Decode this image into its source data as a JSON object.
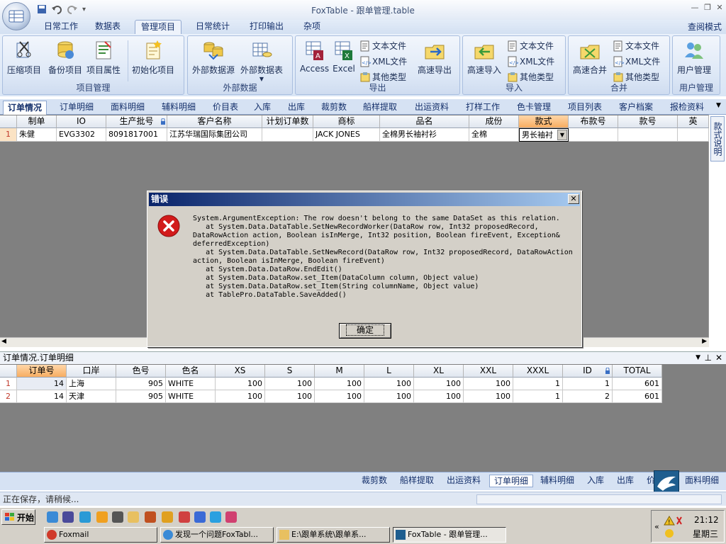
{
  "window": {
    "title": "FoxTable - 跟单管理.table"
  },
  "ribbon_tabs": [
    "日常工作",
    "数据表",
    "管理项目",
    "日常统计",
    "打印输出",
    "杂项"
  ],
  "read_mode": "查阅模式",
  "groups": {
    "project": {
      "label": "项目管理",
      "buttons": [
        "压缩项目",
        "备份项目",
        "项目属性",
        "初始化项目"
      ]
    },
    "external": {
      "label": "外部数据",
      "buttons": [
        "外部数据源",
        "外部数据表"
      ]
    },
    "export": {
      "label": "导出",
      "big": [
        "Access",
        "Excel"
      ],
      "small": [
        "文本文件",
        "XML文件",
        "其他类型"
      ],
      "fast": "高速导出"
    },
    "import": {
      "label": "导入",
      "fast": "高速导入",
      "small": [
        "文本文件",
        "XML文件",
        "其他类型"
      ]
    },
    "merge": {
      "label": "合并",
      "fast": "高速合并",
      "small": [
        "文本文件",
        "XML文件",
        "其他类型"
      ]
    },
    "users": {
      "label": "用户管理",
      "button": "用户管理"
    }
  },
  "doc_tabs": [
    "订单情况",
    "订单明细",
    "面料明细",
    "辅料明细",
    "价目表",
    "入库",
    "出库",
    "裁剪数",
    "船样提取",
    "出运资料",
    "打样工作",
    "色卡管理",
    "项目列表",
    "客户档案",
    "报检资料"
  ],
  "side_tab": "款式说明",
  "top_grid": {
    "headers": [
      "制单",
      "IO",
      "生产批号",
      "客户名称",
      "计划订单数",
      "商标",
      "品名",
      "成份",
      "款式",
      "布款号",
      "款号",
      "英"
    ],
    "row": {
      "num": "1",
      "cells": [
        "朱健",
        "EVG3302",
        "8091817001",
        "江苏华瑞国际集团公司",
        "",
        "JACK JONES",
        "全棉男长袖衬衫",
        "全棉",
        "男长袖衬",
        "",
        "",
        ""
      ]
    }
  },
  "dialog": {
    "title": "错误",
    "message": "System.ArgumentException: The row doesn't belong to the same DataSet as this relation.\n   at System.Data.DataTable.SetNewRecordWorker(DataRow row, Int32 proposedRecord, DataRowAction action, Boolean isInMerge, Int32 position, Boolean fireEvent, Exception& deferredException)\n   at System.Data.DataTable.SetNewRecord(DataRow row, Int32 proposedRecord, DataRowAction action, Boolean isInMerge, Boolean fireEvent)\n   at System.Data.DataRow.EndEdit()\n   at System.Data.DataRow.set_Item(DataColumn column, Object value)\n   at System.Data.DataRow.set_Item(String columnName, Object value)\n   at TablePro.DataTable.SaveAdded()",
    "ok": "确定"
  },
  "lower_panel": {
    "title": "订单情况.订单明细",
    "headers": [
      "订单号",
      "口岸",
      "色号",
      "色名",
      "XS",
      "S",
      "M",
      "L",
      "XL",
      "XXL",
      "XXXL",
      "ID",
      "TOTAL"
    ],
    "rows": [
      {
        "num": "1",
        "cells": [
          "14",
          "上海",
          "905",
          "WHITE",
          "100",
          "100",
          "100",
          "100",
          "100",
          "100",
          "1",
          "1",
          "601"
        ]
      },
      {
        "num": "2",
        "cells": [
          "14",
          "天津",
          "905",
          "WHITE",
          "100",
          "100",
          "100",
          "100",
          "100",
          "100",
          "1",
          "2",
          "601"
        ]
      }
    ]
  },
  "bottom_tabs": [
    "裁剪数",
    "船样提取",
    "出运资料",
    "订单明细",
    "辅料明细",
    "入库",
    "出库",
    "价",
    "面料明细"
  ],
  "status": "正在保存，请稍候...",
  "taskbar": {
    "start": "开始",
    "buttons": [
      "Foxmail",
      "发现一个问题FoxTabl...",
      "E:\\跟单系统\\跟单系...",
      "FoxTable - 跟单管理..."
    ],
    "time": "21:12",
    "day": "星期三"
  }
}
